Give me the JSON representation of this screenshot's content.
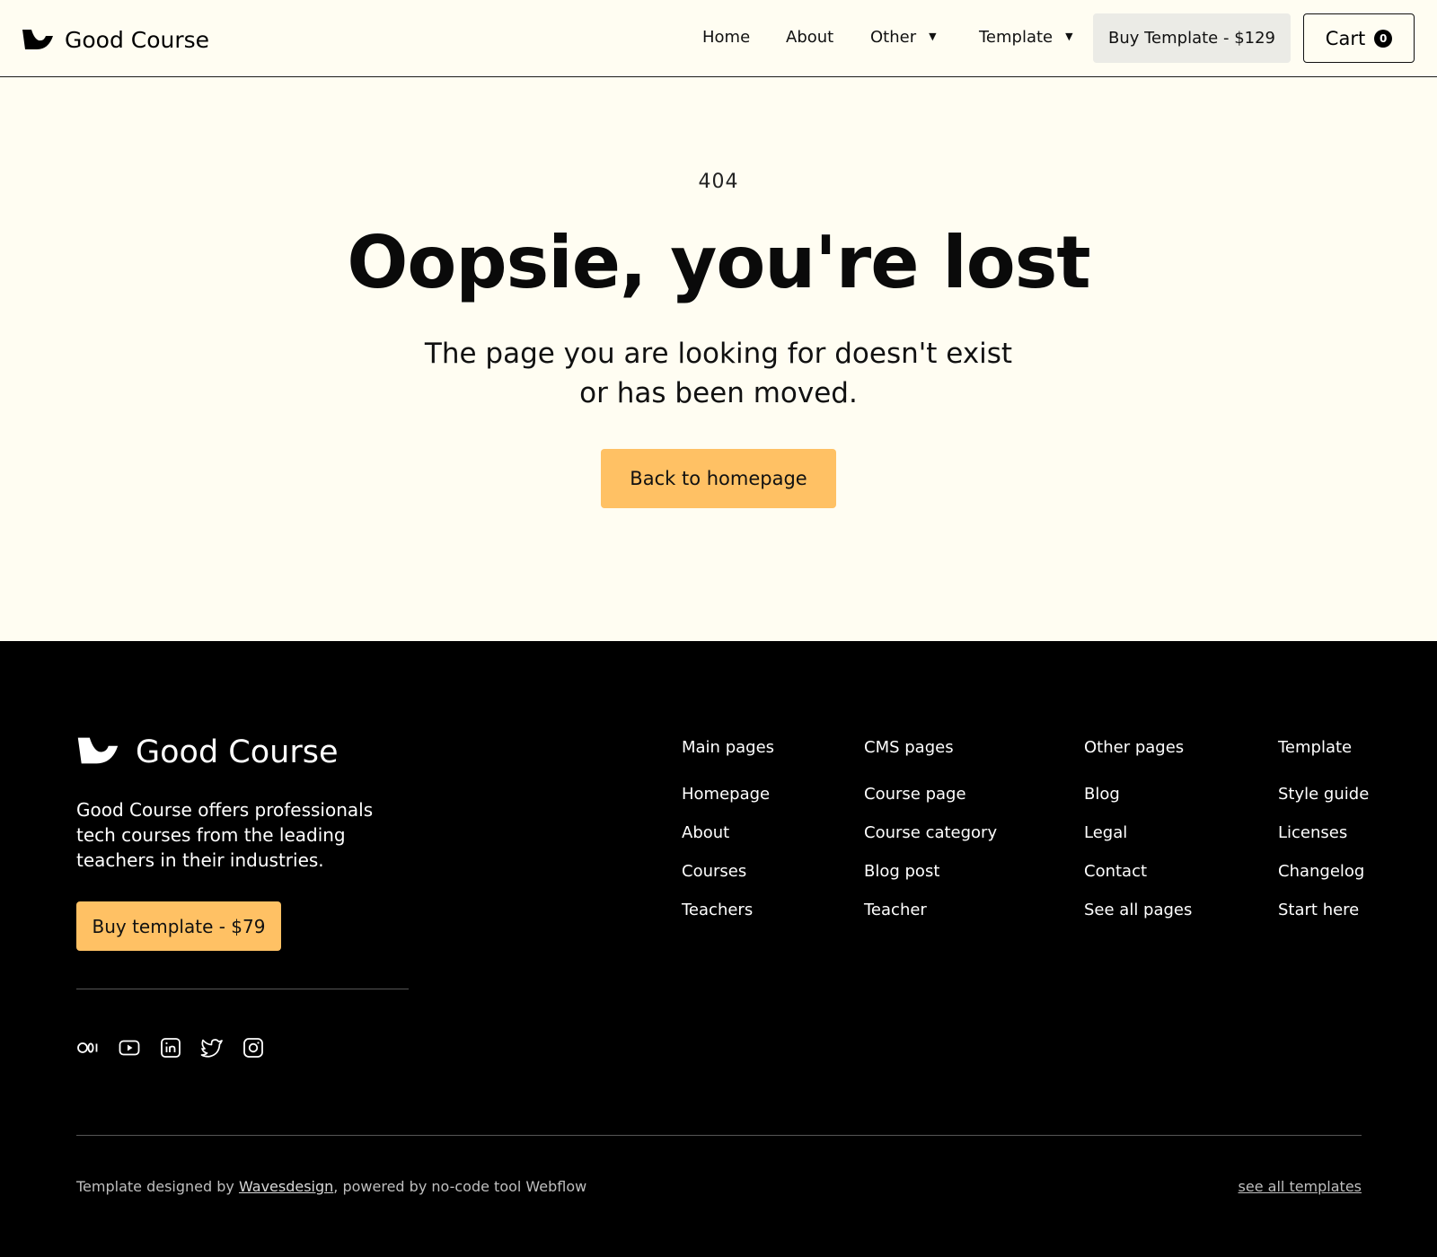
{
  "nav": {
    "brand": "Good Course",
    "links": [
      "Home",
      "About",
      "Other",
      "Template"
    ],
    "buy_button": "Buy Template - $129",
    "cart_label": "Cart",
    "cart_count": "0"
  },
  "hero": {
    "code": "404",
    "title": "Oopsie, you're lost",
    "subtitle": "The page you are looking for doesn't exist or has been moved.",
    "button": "Back to homepage"
  },
  "footer": {
    "brand": "Good Course",
    "description": "Good Course offers professionals tech courses from the leading teachers in their industries.",
    "buy_button": "Buy template - $79",
    "socials": [
      "medium-icon",
      "youtube-icon",
      "linkedin-icon",
      "twitter-icon",
      "instagram-icon"
    ],
    "columns": [
      {
        "title": "Main pages",
        "items": [
          "Homepage",
          "About",
          "Courses",
          "Teachers"
        ]
      },
      {
        "title": "CMS pages",
        "items": [
          "Course page",
          "Course category",
          "Blog post",
          "Teacher"
        ]
      },
      {
        "title": "Other pages",
        "items": [
          "Blog",
          "Legal",
          "Contact",
          "See all pages"
        ]
      },
      {
        "title": "Template",
        "items": [
          "Style guide",
          "Licenses",
          "Changelog",
          "Start here"
        ]
      }
    ],
    "credit_prefix": "Template designed by ",
    "credit_link": "Wavesdesign",
    "credit_suffix": ", powered by no-code tool Webflow",
    "all_templates": "see all templates"
  },
  "colors": {
    "page_bg": "#fffdf2",
    "accent": "#ffc164",
    "footer_bg": "#000000"
  }
}
